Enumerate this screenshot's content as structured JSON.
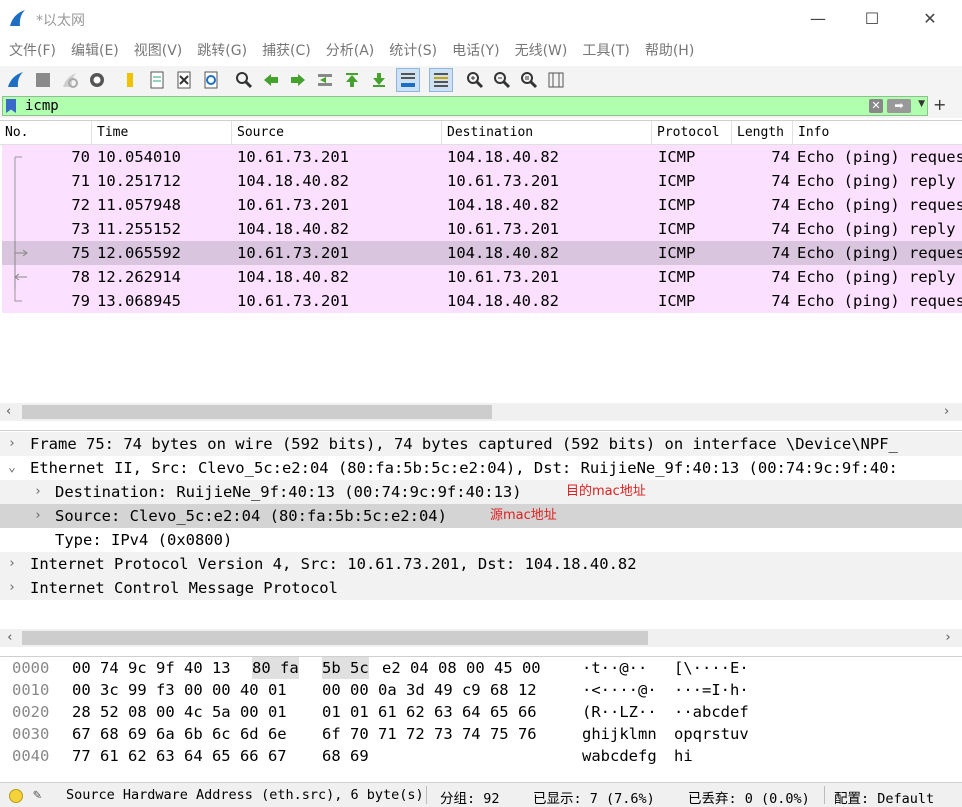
{
  "window": {
    "title": "*以太网",
    "minimize": "—",
    "maximize": "☐",
    "close": "✕"
  },
  "menu": [
    "文件(F)",
    "编辑(E)",
    "视图(V)",
    "跳转(G)",
    "捕获(C)",
    "分析(A)",
    "统计(S)",
    "电话(Y)",
    "无线(W)",
    "工具(T)",
    "帮助(H)"
  ],
  "toolbar": {
    "icons": [
      "shark-fin-start-icon",
      "stop-icon",
      "restart-icon",
      "options-gear-icon",
      "open-folder-icon",
      "file-icon",
      "close-file-icon",
      "reload-icon",
      "find-packet-icon",
      "go-back-icon",
      "go-forward-icon",
      "go-to-packet-icon",
      "first-packet-icon",
      "last-packet-icon",
      "autoscroll-icon",
      "colorize-icon",
      "zoom-in-icon",
      "zoom-out-icon",
      "normal-size-icon",
      "resize-columns-icon"
    ]
  },
  "filter": {
    "value": "icmp"
  },
  "packet_list": {
    "columns": [
      "No.",
      "Time",
      "Source",
      "Destination",
      "Protocol",
      "Length",
      "Info"
    ],
    "rows": [
      {
        "no": "70",
        "time": "10.054010",
        "src": "10.61.73.201",
        "dst": "104.18.40.82",
        "proto": "ICMP",
        "len": "74",
        "info": "Echo (ping) request"
      },
      {
        "no": "71",
        "time": "10.251712",
        "src": "104.18.40.82",
        "dst": "10.61.73.201",
        "proto": "ICMP",
        "len": "74",
        "info": "Echo (ping) reply"
      },
      {
        "no": "72",
        "time": "11.057948",
        "src": "10.61.73.201",
        "dst": "104.18.40.82",
        "proto": "ICMP",
        "len": "74",
        "info": "Echo (ping) request"
      },
      {
        "no": "73",
        "time": "11.255152",
        "src": "104.18.40.82",
        "dst": "10.61.73.201",
        "proto": "ICMP",
        "len": "74",
        "info": "Echo (ping) reply"
      },
      {
        "no": "75",
        "time": "12.065592",
        "src": "10.61.73.201",
        "dst": "104.18.40.82",
        "proto": "ICMP",
        "len": "74",
        "info": "Echo (ping) request"
      },
      {
        "no": "78",
        "time": "12.262914",
        "src": "104.18.40.82",
        "dst": "10.61.73.201",
        "proto": "ICMP",
        "len": "74",
        "info": "Echo (ping) reply"
      },
      {
        "no": "79",
        "time": "13.068945",
        "src": "10.61.73.201",
        "dst": "104.18.40.82",
        "proto": "ICMP",
        "len": "74",
        "info": "Echo (ping) request"
      }
    ]
  },
  "details": {
    "frame": "Frame 75: 74 bytes on wire (592 bits), 74 bytes captured (592 bits) on interface \\Device\\NPF_",
    "ethernet": "Ethernet II, Src: Clevo_5c:e2:04 (80:fa:5b:5c:e2:04), Dst: RuijieNe_9f:40:13 (00:74:9c:9f:40:",
    "eth_dst": "Destination: RuijieNe_9f:40:13 (00:74:9c:9f:40:13)",
    "eth_dst_note": "目的mac地址",
    "eth_src": "Source: Clevo_5c:e2:04 (80:fa:5b:5c:e2:04)",
    "eth_src_note": "源mac地址",
    "eth_type": "Type: IPv4 (0x0800)",
    "ip": "Internet Protocol Version 4, Src: 10.61.73.201, Dst: 104.18.40.82",
    "icmp": "Internet Control Message Protocol"
  },
  "bytes": [
    {
      "off": "0000",
      "h1": "00 74 9c 9f 40 13",
      "h1b": "80 fa",
      "h2a": "5b 5c",
      "h2b": "e2 04 08 00 45 00",
      "a1": "·t··@··",
      "a2": "[\\····E·"
    },
    {
      "off": "0010",
      "h1": "00 3c 99 f3 00 00 40 01",
      "h1b": "",
      "h2a": "00 00 0a 3d 49 c9 68 12",
      "h2b": "",
      "a1": "·<····@·",
      "a2": "···=I·h·"
    },
    {
      "off": "0020",
      "h1": "28 52 08 00 4c 5a 00 01",
      "h1b": "",
      "h2a": "01 01 61 62 63 64 65 66",
      "h2b": "",
      "a1": "(R··LZ··",
      "a2": "··abcdef"
    },
    {
      "off": "0030",
      "h1": "67 68 69 6a 6b 6c 6d 6e",
      "h1b": "",
      "h2a": "6f 70 71 72 73 74 75 76",
      "h2b": "",
      "a1": "ghijklmn",
      "a2": "opqrstuv"
    },
    {
      "off": "0040",
      "h1": "77 61 62 63 64 65 66 67",
      "h1b": "",
      "h2a": "68 69",
      "h2b": "",
      "a1": "wabcdefg",
      "a2": "hi"
    }
  ],
  "status": {
    "field": "Source Hardware Address (eth.src), 6 byte(s)",
    "packets": "分组: 92",
    "displayed": "已显示: 7 (7.6%)",
    "dropped": "已丢弃: 0 (0.0%)",
    "profile": "配置: Default"
  }
}
